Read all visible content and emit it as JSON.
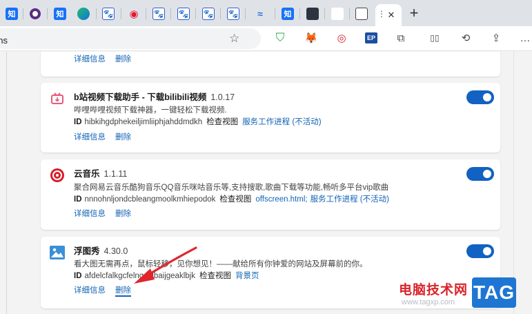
{
  "tabs": [
    {
      "icon": "zhihu-favicon",
      "label": "知"
    },
    {
      "icon": "circle-favicon",
      "label": ""
    },
    {
      "icon": "zhihu-favicon",
      "label": "知"
    },
    {
      "icon": "edge-favicon",
      "label": ""
    },
    {
      "icon": "baidu-favicon",
      "label": "🐾"
    },
    {
      "icon": "weibo-favicon",
      "label": "◉"
    },
    {
      "icon": "baidu-favicon",
      "label": "🐾"
    },
    {
      "icon": "baidu-favicon",
      "label": "🐾"
    },
    {
      "icon": "baidu-favicon",
      "label": "🐾"
    },
    {
      "icon": "ai-favicon",
      "label": "≈"
    },
    {
      "icon": "zhihu-favicon",
      "label": "知"
    },
    {
      "icon": "tablet-favicon",
      "label": ""
    },
    {
      "icon": "blank-favicon",
      "label": ""
    },
    {
      "icon": "grid-favicon",
      "label": ""
    }
  ],
  "active_tab": {
    "close": "✕",
    "menu": "⋮"
  },
  "new_tab_label": "+",
  "address": {
    "text": "ons"
  },
  "toolbar_icons": [
    {
      "name": "shield-icon",
      "glyph": "⛉"
    },
    {
      "name": "fox-icon",
      "glyph": "🦊"
    },
    {
      "name": "target-icon",
      "glyph": "◎"
    },
    {
      "name": "ep-icon",
      "glyph": "EP"
    },
    {
      "name": "extensions-icon",
      "glyph": "⧉"
    },
    {
      "name": "split-screen-icon",
      "glyph": "▯▯"
    },
    {
      "name": "history-icon",
      "glyph": "⟲"
    },
    {
      "name": "share-icon",
      "glyph": "⇪"
    },
    {
      "name": "more-icon",
      "glyph": "…"
    }
  ],
  "extensions": [
    {
      "name": "",
      "version": "",
      "description": "",
      "actions": {
        "details": "详细信息",
        "remove": "删除"
      }
    },
    {
      "name": "b站视频下载助手 - 下载bilibili视频",
      "version": "1.0.17",
      "description": "哔哩哔哩视频下载神器，一键轻松下载视频.",
      "id_label": "ID",
      "id": "hibkihgdphekeiljimliiphjahddmdkh",
      "view_label": "检查视图",
      "view_links": [
        "服务工作进程 (不活动)"
      ],
      "actions": {
        "details": "详细信息",
        "remove": "删除"
      },
      "enabled": true
    },
    {
      "name": "云音乐",
      "version": "1.1.11",
      "description": "聚合网易云音乐酷狗音乐QQ音乐咪咕音乐等,支持搜歌,歌曲下载等功能,畅听多平台vip歌曲",
      "id_label": "ID",
      "id": "nnnohnljondcbleangmoolkmhiepodok",
      "view_label": "检查视图",
      "view_links": [
        "offscreen.html;",
        "服务工作进程 (不活动)"
      ],
      "actions": {
        "details": "详细信息",
        "remove": "删除"
      },
      "enabled": true
    },
    {
      "name": "浮图秀",
      "version": "4.30.0",
      "description": "看大图无需再点，鼠标轻移，见你想见！——献给所有你钟爱的网站及屏幕前的你。",
      "id_label": "ID",
      "id": "afdelcfalkgcfelngdclbaijgeaklbjk",
      "view_label": "检查视图",
      "view_links": [
        "背景页"
      ],
      "actions": {
        "details": "详细信息",
        "remove": "删除"
      },
      "enabled": true
    }
  ],
  "watermark": {
    "text": "电脑技术网",
    "url": "www.tagxp.com",
    "tag": "TAG"
  },
  "colors": {
    "accent": "#1162c2",
    "link": "#1163b5",
    "arrow": "#e0262c"
  }
}
